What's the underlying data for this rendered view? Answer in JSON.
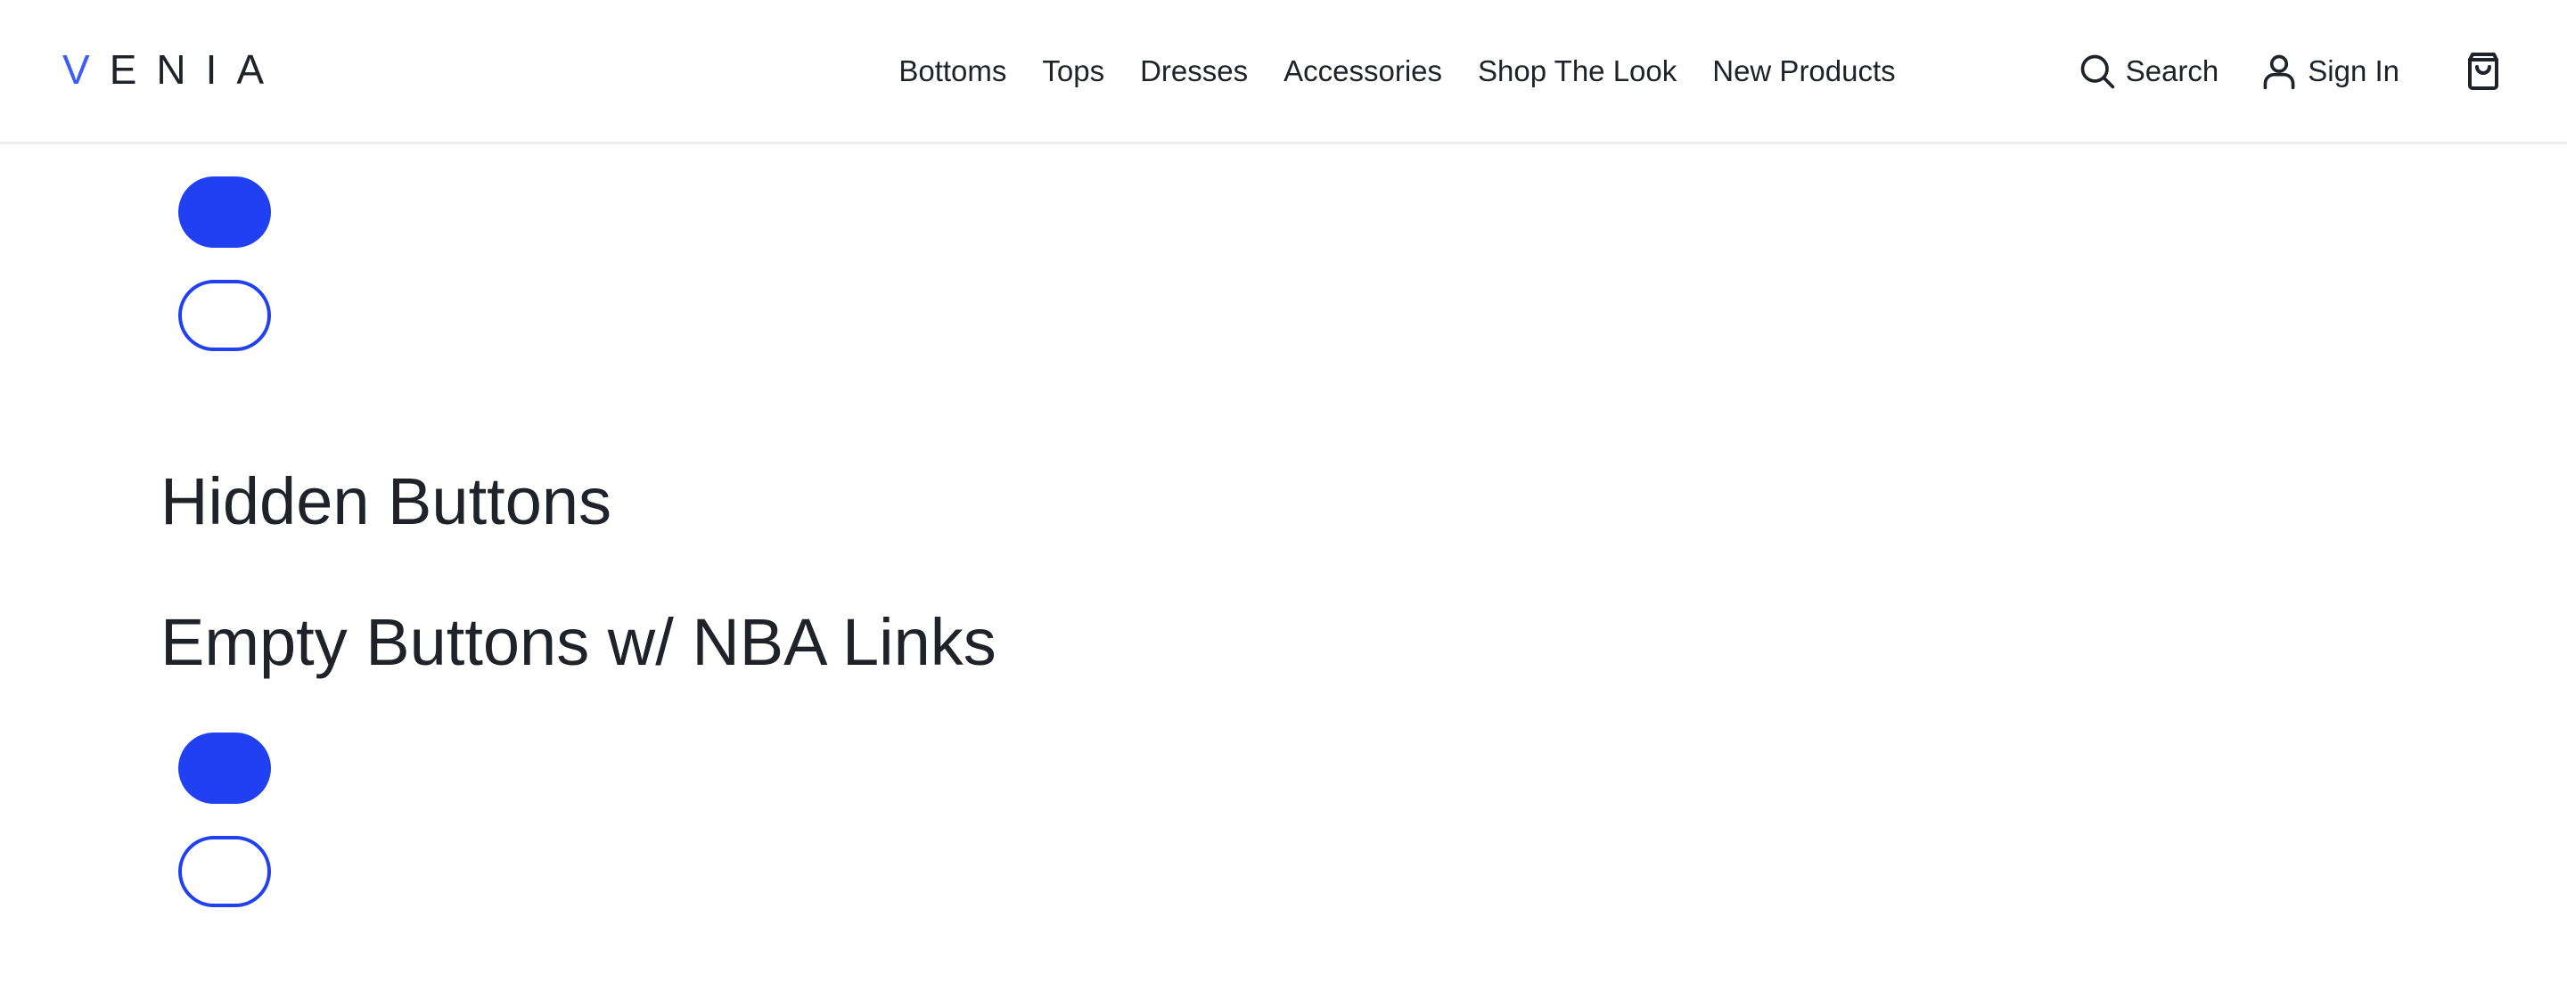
{
  "header": {
    "logo": {
      "first": "V",
      "rest": "ENIA"
    },
    "nav": [
      {
        "label": "Bottoms"
      },
      {
        "label": "Tops"
      },
      {
        "label": "Dresses"
      },
      {
        "label": "Accessories"
      },
      {
        "label": "Shop The Look"
      },
      {
        "label": "New Products"
      }
    ],
    "search_label": "Search",
    "signin_label": "Sign In",
    "icons": {
      "search": "search-icon",
      "account": "user-icon",
      "cart": "shopping-bag-icon"
    }
  },
  "main": {
    "sections": [
      {
        "title": "Hidden Buttons"
      },
      {
        "title": "Empty Buttons w/ NBA Links"
      }
    ]
  },
  "colors": {
    "accent": "#2140f2",
    "logo_accent": "#3b5df5",
    "text": "#1f2229",
    "divider": "#eeeeee",
    "background": "#ffffff"
  }
}
